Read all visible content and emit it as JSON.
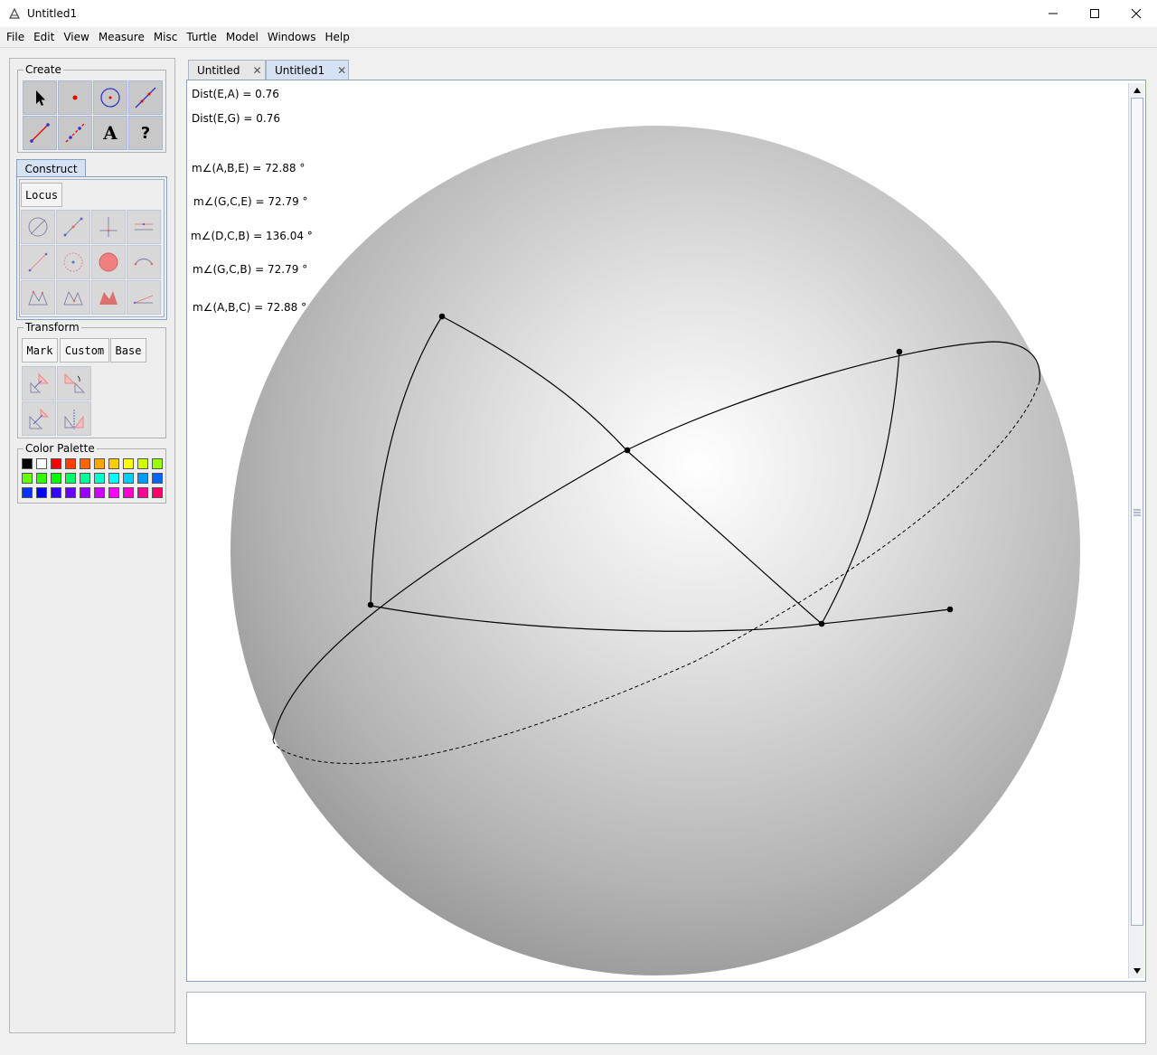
{
  "window": {
    "title": "Untitled1"
  },
  "menu": [
    "File",
    "Edit",
    "View",
    "Measure",
    "Misc",
    "Turtle",
    "Model",
    "Windows",
    "Help"
  ],
  "left_panel": {
    "create_title": "Create",
    "construct_tab": "Construct",
    "locus_label": "Locus",
    "transform_title": "Transform",
    "transform_buttons": [
      "Mark",
      "Custom",
      "Base"
    ],
    "color_palette_title": "Color Palette",
    "text_tool_glyph": "A",
    "help_tool_glyph": "?"
  },
  "colors": {
    "row1": [
      "#000000",
      "#ffffff",
      "#ff0000",
      "#ff4000",
      "#ff6600",
      "#ffa500",
      "#ffcc00",
      "#ffff00",
      "#ccff00",
      "#99ff00"
    ],
    "row2": [
      "#66ff00",
      "#33ff00",
      "#00ff00",
      "#00ff66",
      "#00ff99",
      "#00ffcc",
      "#00ffff",
      "#00ccff",
      "#0099ff",
      "#0066ff"
    ],
    "row3": [
      "#0033ff",
      "#0000ff",
      "#3300ff",
      "#6600ff",
      "#9900ff",
      "#cc00ff",
      "#ff00ff",
      "#ff00cc",
      "#ff0099",
      "#ff0066"
    ]
  },
  "tabs": [
    {
      "label": "Untitled",
      "close": "✕"
    },
    {
      "label": "Untitled1",
      "close": "✕"
    }
  ],
  "measurements": [
    "Dist(E,A) = 0.76",
    "Dist(E,G) = 0.76",
    "m∠(A,B,E) = 72.88 °",
    "m∠(G,C,E) = 72.79 °",
    "m∠(D,C,B) = 136.04 °",
    "m∠(G,C,B) = 72.79 °",
    "m∠(A,B,C) = 72.88 °"
  ],
  "icons": {
    "minimize": "minimize-icon",
    "maximize": "maximize-icon",
    "close": "close-icon",
    "app": "app-icon"
  }
}
